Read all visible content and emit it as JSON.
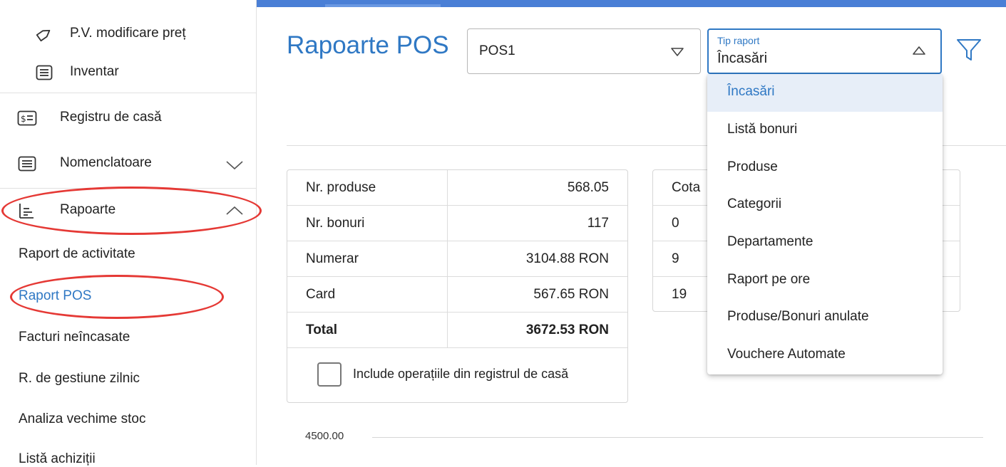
{
  "sidebar": {
    "items": [
      {
        "label": "P.V. modificare preț",
        "icon": "tag-icon"
      },
      {
        "label": "Inventar",
        "icon": "list-icon"
      },
      {
        "label": "Registru de casă",
        "icon": "cash-register-icon"
      },
      {
        "label": "Nomenclatoare",
        "icon": "list-icon"
      },
      {
        "label": "Rapoarte",
        "icon": "report-icon"
      }
    ],
    "subitems": [
      {
        "label": "Raport de activitate"
      },
      {
        "label": "Raport POS"
      },
      {
        "label": "Facturi neîncasate"
      },
      {
        "label": "R. de gestiune zilnic"
      },
      {
        "label": "Analiza vechime stoc"
      },
      {
        "label": "Listă achiziții"
      }
    ]
  },
  "header": {
    "title": "Rapoarte POS",
    "pos_select": {
      "value": "POS1"
    },
    "report_type": {
      "label": "Tip raport",
      "value": "Încasări"
    }
  },
  "dropdown": {
    "options": [
      "Încasări",
      "Listă bonuri",
      "Produse",
      "Categorii",
      "Departamente",
      "Raport pe ore",
      "Produse/Bonuri anulate",
      "Vouchere Automate"
    ]
  },
  "summary": {
    "rows": [
      {
        "label": "Nr. produse",
        "value": "568.05"
      },
      {
        "label": "Nr. bonuri",
        "value": "117"
      },
      {
        "label": "Numerar",
        "value": "3104.88 RON"
      },
      {
        "label": "Card",
        "value": "567.65 RON"
      },
      {
        "label": "Total",
        "value": "3672.53 RON"
      }
    ],
    "include_label": "Include operațiile din registrul de casă"
  },
  "vat_table": {
    "header": "Cota",
    "rows": [
      "0",
      "9",
      "19"
    ]
  },
  "chart": {
    "y_label": "4500.00"
  },
  "colors": {
    "accent": "#2f78c4",
    "annotation": "#e53935",
    "topbar": "#4a7fd6"
  }
}
